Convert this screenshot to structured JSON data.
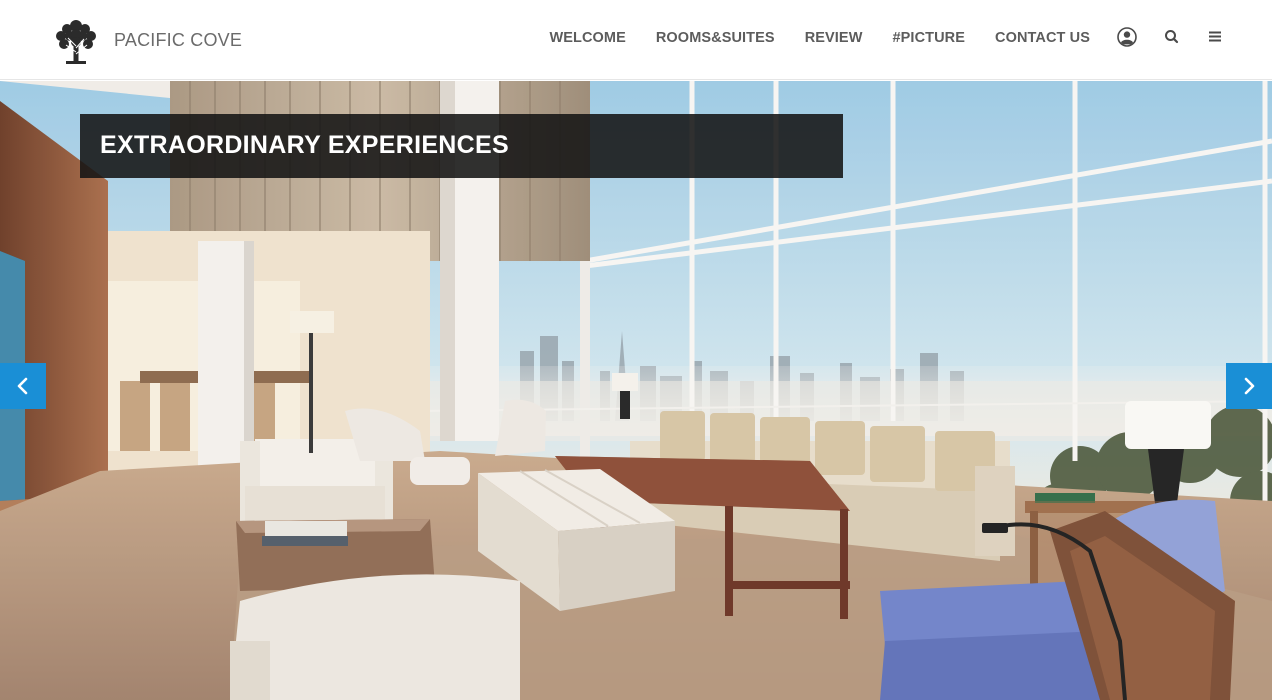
{
  "brand": {
    "name": "PACIFIC COVE",
    "logo_icon": "tree-logo-icon"
  },
  "nav": {
    "items": [
      {
        "label": "WELCOME"
      },
      {
        "label": "ROOMS&SUITES"
      },
      {
        "label": "REVIEW"
      },
      {
        "label": "#PICTURE"
      },
      {
        "label": "CONTACT US"
      }
    ],
    "icons": [
      "user-icon",
      "search-icon",
      "menu-icon"
    ]
  },
  "hero": {
    "headline": "EXTRAORDINARY EXPERIENCES",
    "prev_icon": "chevron-left-icon",
    "next_icon": "chevron-right-icon"
  },
  "colors": {
    "accent": "#1a8fd6",
    "nav_text": "#5c5c5c",
    "headline_bg": "#141414"
  }
}
